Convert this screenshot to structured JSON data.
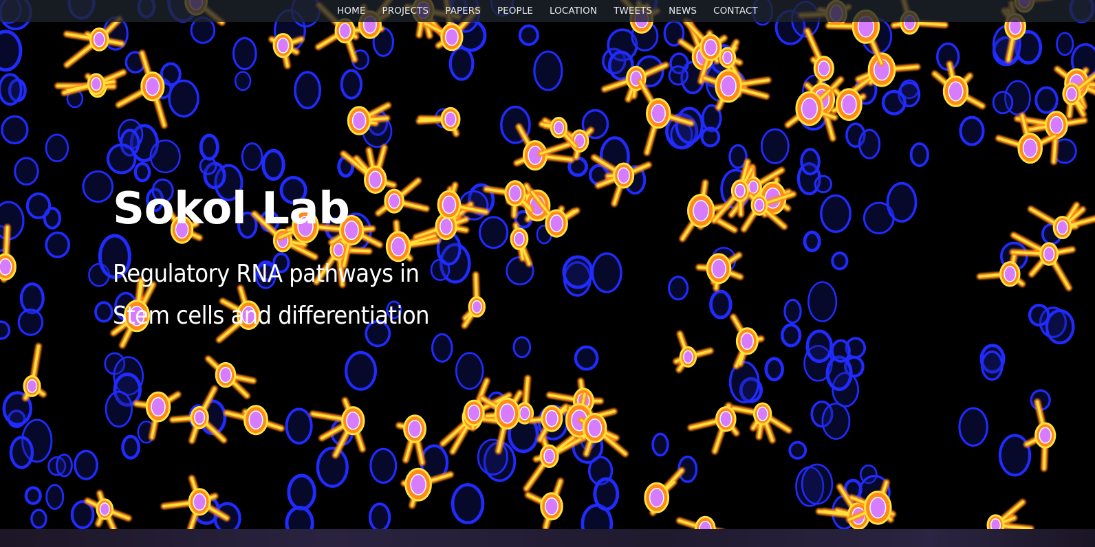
{
  "nav": {
    "items": [
      {
        "label": "HOME"
      },
      {
        "label": "PROJECTS"
      },
      {
        "label": "PAPERS"
      },
      {
        "label": "PEOPLE"
      },
      {
        "label": "LOCATION"
      },
      {
        "label": "TWEETS"
      },
      {
        "label": "NEWS"
      },
      {
        "label": "CONTACT"
      }
    ]
  },
  "hero": {
    "title": "Sokol Lab",
    "subtitle_line1": "Regulatory RNA pathways in",
    "subtitle_line2": "Stem cells and differentiation",
    "background_image": "fluorescent-cell-microscopy",
    "colors": {
      "nuclei": "#1f2bff",
      "cell_outer": "#ff8a1c",
      "cell_inner": "#ffe23a",
      "cell_core": "#d77cff"
    }
  }
}
